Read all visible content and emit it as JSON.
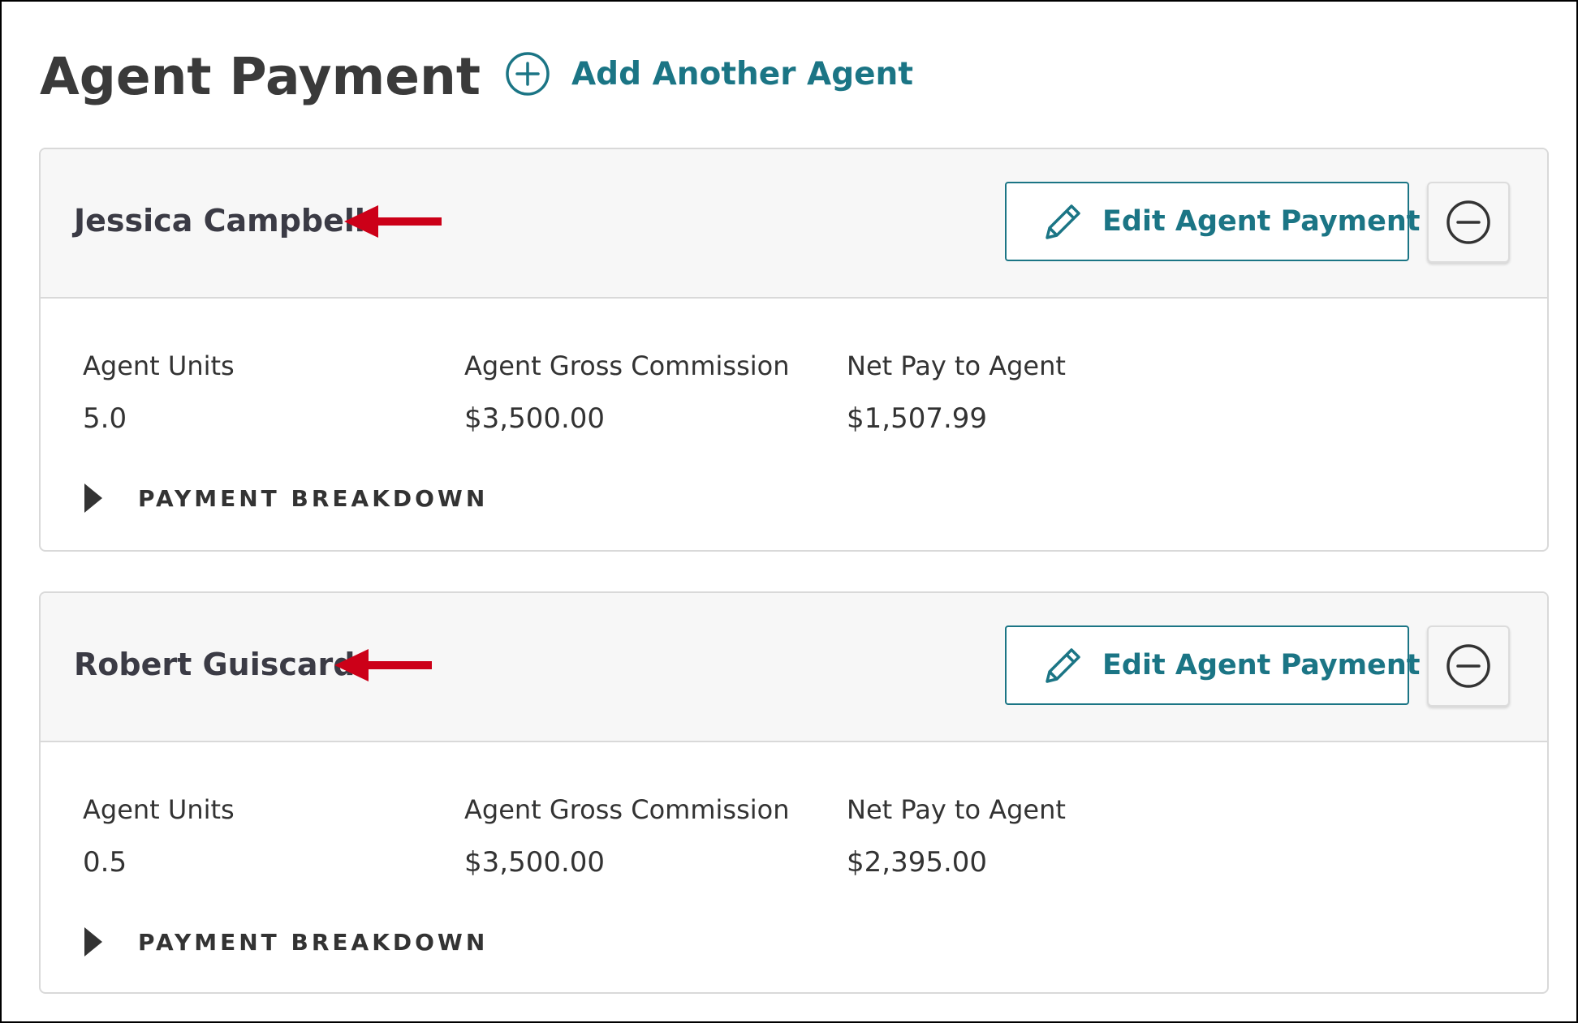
{
  "page": {
    "title": "Agent Payment",
    "add_agent_label": "Add Another Agent"
  },
  "colors": {
    "accent": "#1b7585",
    "annotation_arrow": "#cc0018",
    "card_header_bg": "#f7f7f7",
    "border": "#d9d9d9"
  },
  "agents": [
    {
      "name": "Jessica Campbell",
      "edit_label": "Edit Agent Payment",
      "remove_icon": "minus-circle-icon",
      "stats": {
        "units_label": "Agent Units",
        "units_value": "5.0",
        "gross_label": "Agent Gross Commission",
        "gross_value": "$3,500.00",
        "net_label": "Net Pay to Agent",
        "net_value": "$1,507.99"
      },
      "breakdown_label": "PAYMENT BREAKDOWN"
    },
    {
      "name": "Robert Guiscard",
      "edit_label": "Edit Agent Payment",
      "remove_icon": "minus-circle-icon",
      "stats": {
        "units_label": "Agent Units",
        "units_value": "0.5",
        "gross_label": "Agent Gross Commission",
        "gross_value": "$3,500.00",
        "net_label": "Net Pay to Agent",
        "net_value": "$2,395.00"
      },
      "breakdown_label": "PAYMENT BREAKDOWN"
    }
  ],
  "icons": {
    "add": "plus-circle-icon",
    "edit": "pencil-icon",
    "remove": "minus-circle-icon",
    "expand": "caret-right-icon",
    "annotation": "red-arrow-icon"
  }
}
